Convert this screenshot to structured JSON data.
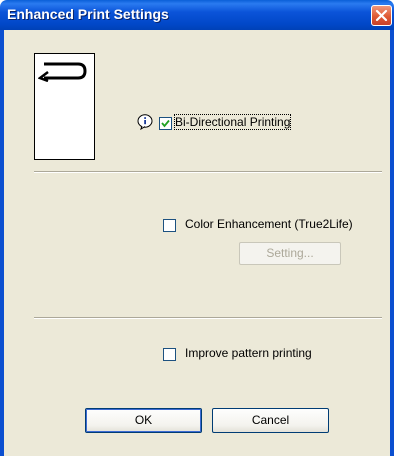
{
  "window": {
    "title": "Enhanced Print Settings",
    "close_icon": "close-x-icon"
  },
  "options": {
    "bidirectional": {
      "label": "Bi-Directional Printing",
      "checked": true
    },
    "color_enhancement": {
      "label": "Color Enhancement (True2Life)",
      "checked": false
    },
    "improve_pattern": {
      "label": "Improve pattern printing",
      "checked": false
    }
  },
  "buttons": {
    "setting": "Setting...",
    "ok": "OK",
    "cancel": "Cancel"
  },
  "icons": {
    "info": "info-balloon-icon",
    "preview": "bidirectional-paper-preview-icon"
  },
  "colors": {
    "titlebar": "#0054e3",
    "dialog_bg": "#ece9d8",
    "close_button": "#e0583a"
  }
}
